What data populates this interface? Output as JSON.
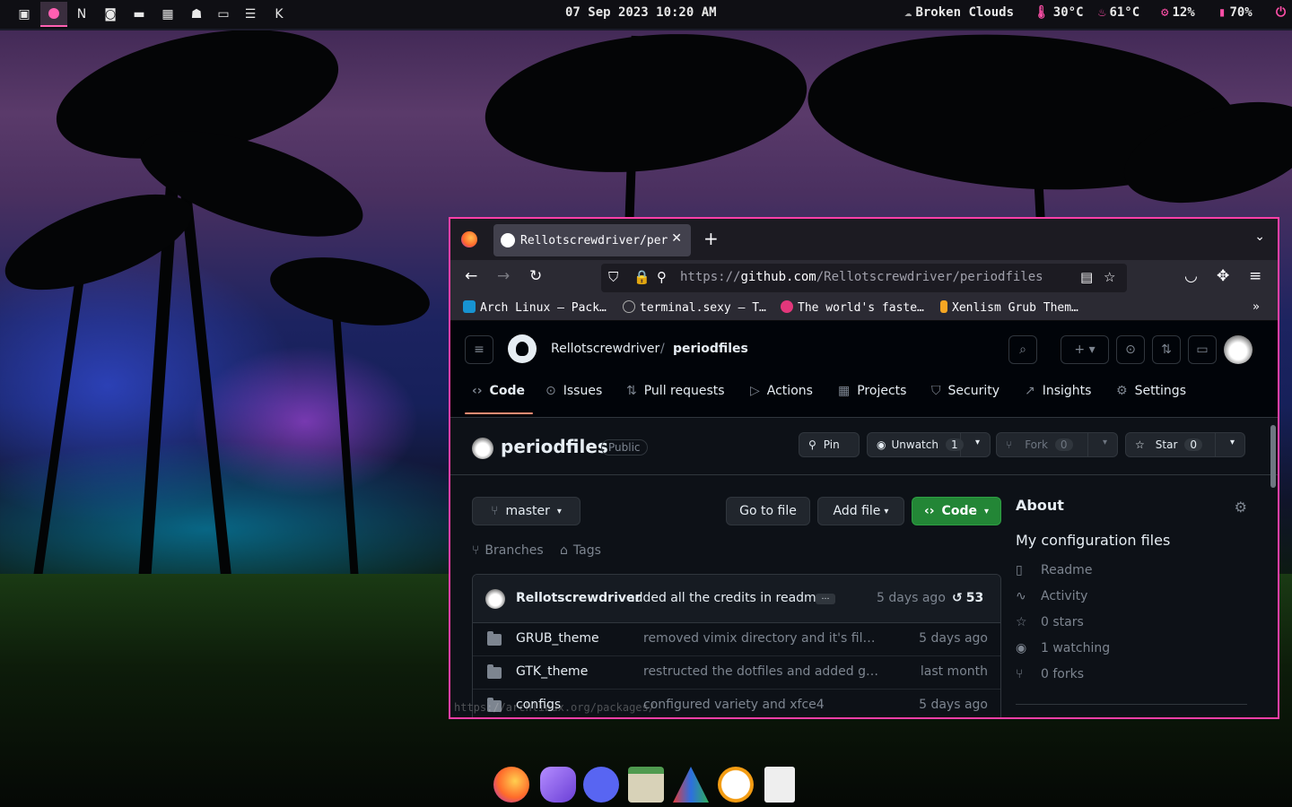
{
  "topbar": {
    "workspace_icons": [
      "terminal-icon",
      "app-icon",
      "notion-icon",
      "discord-icon",
      "folder-icon",
      "grid-icon",
      "ghost-icon",
      "screen-icon",
      "database-icon",
      "kde-icon"
    ],
    "datetime": "07 Sep 2023 10:20 AM",
    "weather": "Broken Clouds",
    "temp_outside": "30°C",
    "temp_cpu": "61°C",
    "cpu": "12%",
    "battery": "70%"
  },
  "browser": {
    "tab_title": "Rellotscrewdriver/periodfiles",
    "url_scheme": "https://",
    "url_host": "github.com",
    "url_path": "/Rellotscrewdriver/periodfiles",
    "bookmarks": [
      {
        "label": "Arch Linux – Pack…",
        "color": "#1793d1"
      },
      {
        "label": "terminal.sexy – T…",
        "color": "#aaaaaa"
      },
      {
        "label": "The world's faste…",
        "color": "#e3377b"
      },
      {
        "label": "Xenlism Grub Them…",
        "color": "#f5a623"
      }
    ],
    "status_url": "https://archlinux.org/packages/"
  },
  "github": {
    "owner": "Rellotscrewdriver",
    "separator": "/",
    "repo": "periodfiles",
    "nav_tabs": [
      {
        "label": "Code",
        "icon": "code-icon"
      },
      {
        "label": "Issues",
        "icon": "issue-icon"
      },
      {
        "label": "Pull requests",
        "icon": "pr-icon"
      },
      {
        "label": "Actions",
        "icon": "play-icon"
      },
      {
        "label": "Projects",
        "icon": "table-icon"
      },
      {
        "label": "Security",
        "icon": "shield-icon"
      },
      {
        "label": "Insights",
        "icon": "graph-icon"
      },
      {
        "label": "Settings",
        "icon": "gear-icon"
      }
    ],
    "visibility": "Public",
    "pin_label": "Pin",
    "unwatch_label": "Unwatch",
    "unwatch_count": "1",
    "fork_label": "Fork",
    "fork_count": "0",
    "star_label": "Star",
    "star_count": "0",
    "branch": "master",
    "goto_file": "Go to file",
    "add_file": "Add file",
    "code_btn": "Code",
    "branches_label": "Branches",
    "tags_label": "Tags",
    "commit": {
      "user": "Rellotscrewdriver",
      "message": "added all the credits in readme",
      "when": "5 days ago",
      "count": "53"
    },
    "files": [
      {
        "name": "GRUB_theme",
        "message": "removed vimix directory and it's files from GRUB_theme",
        "when": "5 days ago"
      },
      {
        "name": "GTK_theme",
        "message": "restructed the dotfiles and added greeter themes",
        "when": "last month"
      },
      {
        "name": "configs",
        "message": "configured variety and xfce4",
        "when": "5 days ago"
      }
    ],
    "about": {
      "title": "About",
      "description": "My configuration files",
      "readme": "Readme",
      "activity": "Activity",
      "stars": "0 stars",
      "watching": "1 watching",
      "forks": "0 forks"
    }
  },
  "dock": [
    "firefox-icon",
    "obsidian-icon",
    "discord-icon",
    "files-icon",
    "arch-installer-icon",
    "clock-icon",
    "text-editor-icon"
  ]
}
